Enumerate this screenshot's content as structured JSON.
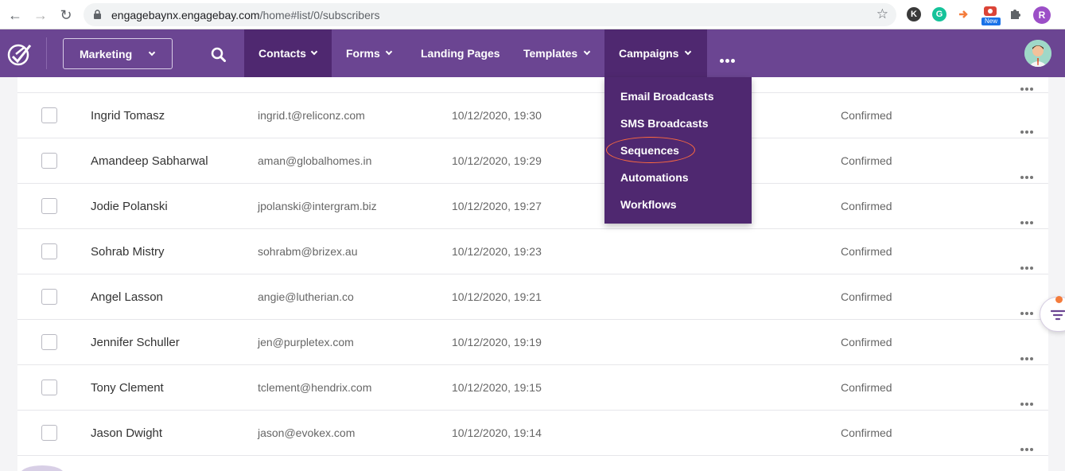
{
  "browser": {
    "url_host": "engagebaynx.engagebay.com",
    "url_path": "/home#list/0/subscribers",
    "extension_badge": "New",
    "profile_initial": "R",
    "ext_k_initial": "K",
    "ext_g_initial": "G"
  },
  "nav": {
    "marketing_label": "Marketing",
    "items": [
      {
        "label": "Contacts"
      },
      {
        "label": "Forms"
      },
      {
        "label": "Landing Pages"
      },
      {
        "label": "Templates"
      },
      {
        "label": "Campaigns"
      }
    ]
  },
  "campaigns_menu": {
    "items": [
      {
        "label": "Email Broadcasts"
      },
      {
        "label": "SMS Broadcasts"
      },
      {
        "label": "Sequences"
      },
      {
        "label": "Automations"
      },
      {
        "label": "Workflows"
      }
    ]
  },
  "subscribers": [
    {
      "name": "Ingrid Tomasz",
      "email": "ingrid.t@reliconz.com",
      "date": "10/12/2020, 19:30",
      "status": "Confirmed"
    },
    {
      "name": "Amandeep Sabharwal",
      "email": "aman@globalhomes.in",
      "date": "10/12/2020, 19:29",
      "status": "Confirmed"
    },
    {
      "name": "Jodie Polanski",
      "email": "jpolanski@intergram.biz",
      "date": "10/12/2020, 19:27",
      "status": "Confirmed"
    },
    {
      "name": "Sohrab Mistry",
      "email": "sohrabm@brizex.au",
      "date": "10/12/2020, 19:23",
      "status": "Confirmed"
    },
    {
      "name": "Angel Lasson",
      "email": "angie@lutherian.co",
      "date": "10/12/2020, 19:21",
      "status": "Confirmed"
    },
    {
      "name": "Jennifer Schuller",
      "email": "jen@purpletex.com",
      "date": "10/12/2020, 19:19",
      "status": "Confirmed"
    },
    {
      "name": "Tony Clement",
      "email": "tclement@hendrix.com",
      "date": "10/12/2020, 19:15",
      "status": "Confirmed"
    },
    {
      "name": "Jason Dwight",
      "email": "jason@evokex.com",
      "date": "10/12/2020, 19:14",
      "status": "Confirmed"
    }
  ],
  "colors": {
    "nav_bg": "#6b4592",
    "nav_active": "#4f2870",
    "highlight": "#ff6a3d"
  },
  "icons": {
    "back": "back-arrow-icon",
    "forward": "forward-arrow-icon",
    "reload": "reload-icon",
    "lock": "lock-icon",
    "bookmark": "star-icon",
    "search": "search-icon",
    "more": "more-dots-icon",
    "filter": "filter-icon",
    "row_menu": "row-menu-icon"
  }
}
